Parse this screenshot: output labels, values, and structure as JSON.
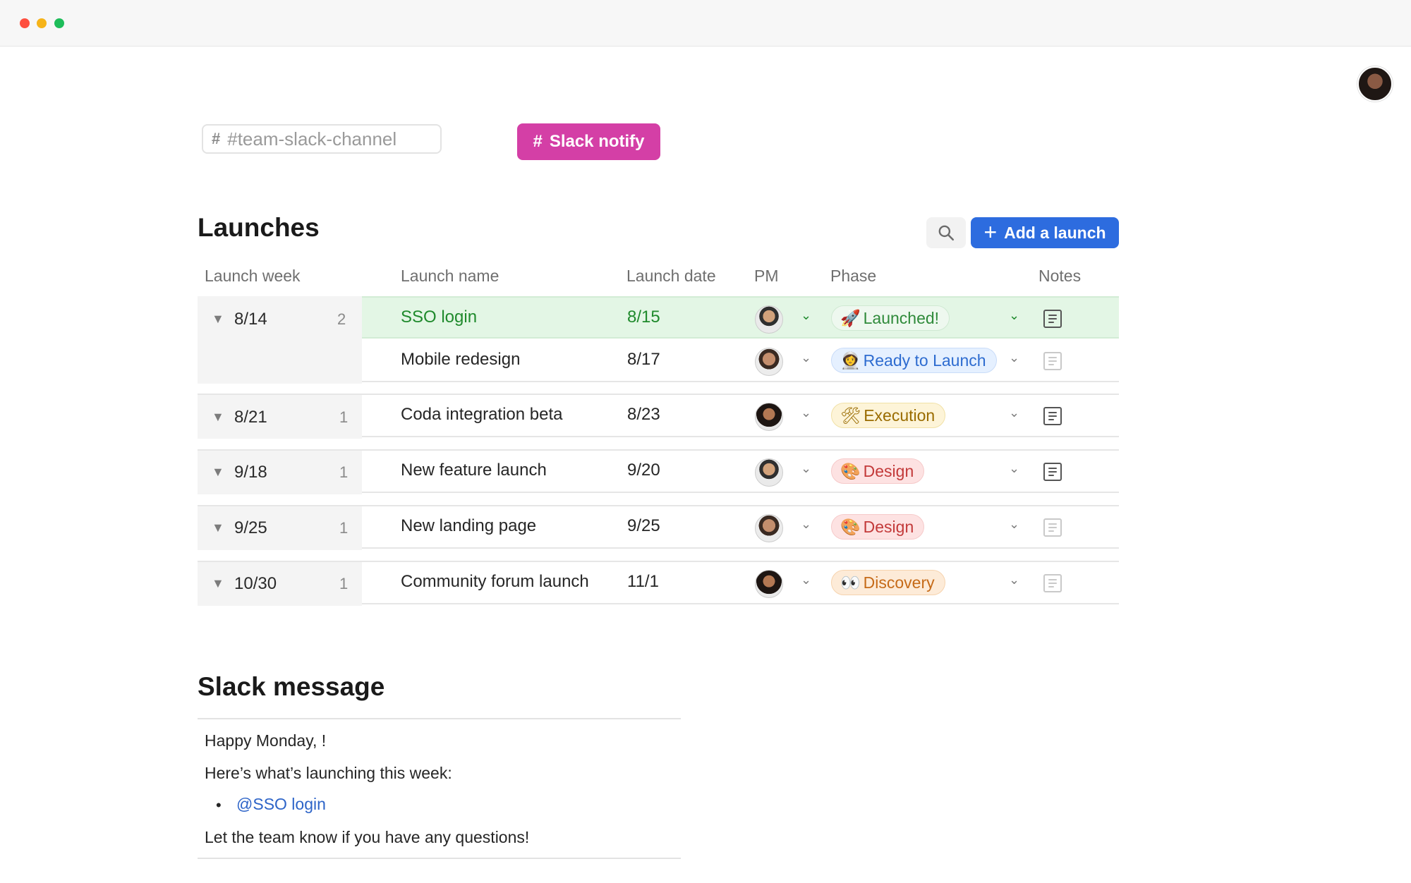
{
  "window": {
    "controls": [
      "close",
      "minimize",
      "maximize"
    ]
  },
  "header": {
    "channel_placeholder": "#team-slack-channel",
    "slack_notify_label": "Slack notify"
  },
  "launches": {
    "title": "Launches",
    "add_label": "Add a launch",
    "columns": {
      "week": "Launch week",
      "name": "Launch name",
      "date": "Launch date",
      "pm": "PM",
      "phase": "Phase",
      "notes": "Notes"
    },
    "groups": [
      {
        "week": "8/14",
        "count": "2",
        "rows": [
          {
            "name": "SSO login",
            "date": "8/15",
            "phase": "Launched!",
            "phase_icon": "🚀",
            "notes": true
          },
          {
            "name": "Mobile redesign",
            "date": "8/17",
            "phase": "Ready to Launch",
            "phase_icon": "👩‍🚀",
            "notes": false
          }
        ]
      },
      {
        "week": "8/21",
        "count": "1",
        "rows": [
          {
            "name": "Coda integration beta",
            "date": "8/23",
            "phase": "Execution",
            "phase_icon": "🛠",
            "notes": true
          }
        ]
      },
      {
        "week": "9/18",
        "count": "1",
        "rows": [
          {
            "name": "New feature launch",
            "date": "9/20",
            "phase": "Design",
            "phase_icon": "🎨",
            "notes": true
          }
        ]
      },
      {
        "week": "9/25",
        "count": "1",
        "rows": [
          {
            "name": "New landing page",
            "date": "9/25",
            "phase": "Design",
            "phase_icon": "🎨",
            "notes": false
          }
        ]
      },
      {
        "week": "10/30",
        "count": "1",
        "rows": [
          {
            "name": "Community forum launch",
            "date": "11/1",
            "phase": "Discovery",
            "phase_icon": "👀",
            "notes": false
          }
        ]
      }
    ]
  },
  "slack_message": {
    "title": "Slack message",
    "greeting": "Happy Monday, !",
    "intro": "Here’s what’s launching this week:",
    "mention": "@SSO login",
    "closing": "Let the team know if you have any questions!"
  }
}
